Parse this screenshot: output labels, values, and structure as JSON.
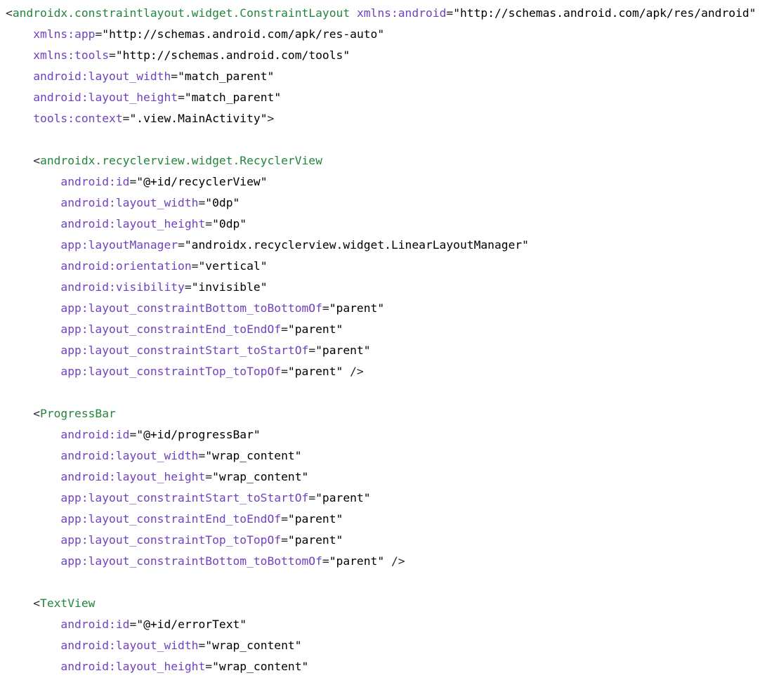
{
  "code": {
    "lines": [
      [
        {
          "t": "<",
          "c": "punct"
        },
        {
          "t": "androidx.constraintlayout.widget.ConstraintLayout",
          "c": "tag"
        },
        {
          "t": " ",
          "c": "punct"
        },
        {
          "t": "xmlns:android",
          "c": "attr"
        },
        {
          "t": "=",
          "c": "punct"
        },
        {
          "t": "\"http://schemas.android.com/apk/res/android\"",
          "c": "str"
        }
      ],
      [
        {
          "t": "    ",
          "c": "punct"
        },
        {
          "t": "xmlns:app",
          "c": "attr"
        },
        {
          "t": "=",
          "c": "punct"
        },
        {
          "t": "\"http://schemas.android.com/apk/res-auto\"",
          "c": "str"
        }
      ],
      [
        {
          "t": "    ",
          "c": "punct"
        },
        {
          "t": "xmlns:tools",
          "c": "attr"
        },
        {
          "t": "=",
          "c": "punct"
        },
        {
          "t": "\"http://schemas.android.com/tools\"",
          "c": "str"
        }
      ],
      [
        {
          "t": "    ",
          "c": "punct"
        },
        {
          "t": "android:layout_width",
          "c": "attr"
        },
        {
          "t": "=",
          "c": "punct"
        },
        {
          "t": "\"match_parent\"",
          "c": "str"
        }
      ],
      [
        {
          "t": "    ",
          "c": "punct"
        },
        {
          "t": "android:layout_height",
          "c": "attr"
        },
        {
          "t": "=",
          "c": "punct"
        },
        {
          "t": "\"match_parent\"",
          "c": "str"
        }
      ],
      [
        {
          "t": "    ",
          "c": "punct"
        },
        {
          "t": "tools:context",
          "c": "attr"
        },
        {
          "t": "=",
          "c": "punct"
        },
        {
          "t": "\".view.MainActivity\"",
          "c": "str"
        },
        {
          "t": ">",
          "c": "punct"
        }
      ],
      [],
      [
        {
          "t": "    <",
          "c": "punct"
        },
        {
          "t": "androidx.recyclerview.widget.RecyclerView",
          "c": "tag"
        }
      ],
      [
        {
          "t": "        ",
          "c": "punct"
        },
        {
          "t": "android:id",
          "c": "attr"
        },
        {
          "t": "=",
          "c": "punct"
        },
        {
          "t": "\"@+id/recyclerView\"",
          "c": "str"
        }
      ],
      [
        {
          "t": "        ",
          "c": "punct"
        },
        {
          "t": "android:layout_width",
          "c": "attr"
        },
        {
          "t": "=",
          "c": "punct"
        },
        {
          "t": "\"0dp\"",
          "c": "str"
        }
      ],
      [
        {
          "t": "        ",
          "c": "punct"
        },
        {
          "t": "android:layout_height",
          "c": "attr"
        },
        {
          "t": "=",
          "c": "punct"
        },
        {
          "t": "\"0dp\"",
          "c": "str"
        }
      ],
      [
        {
          "t": "        ",
          "c": "punct"
        },
        {
          "t": "app:layoutManager",
          "c": "attr"
        },
        {
          "t": "=",
          "c": "punct"
        },
        {
          "t": "\"androidx.recyclerview.widget.LinearLayoutManager\"",
          "c": "str"
        }
      ],
      [
        {
          "t": "        ",
          "c": "punct"
        },
        {
          "t": "android:orientation",
          "c": "attr"
        },
        {
          "t": "=",
          "c": "punct"
        },
        {
          "t": "\"vertical\"",
          "c": "str"
        }
      ],
      [
        {
          "t": "        ",
          "c": "punct"
        },
        {
          "t": "android:visibility",
          "c": "attr"
        },
        {
          "t": "=",
          "c": "punct"
        },
        {
          "t": "\"invisible\"",
          "c": "str"
        }
      ],
      [
        {
          "t": "        ",
          "c": "punct"
        },
        {
          "t": "app:layout_constraintBottom_toBottomOf",
          "c": "attr"
        },
        {
          "t": "=",
          "c": "punct"
        },
        {
          "t": "\"parent\"",
          "c": "str"
        }
      ],
      [
        {
          "t": "        ",
          "c": "punct"
        },
        {
          "t": "app:layout_constraintEnd_toEndOf",
          "c": "attr"
        },
        {
          "t": "=",
          "c": "punct"
        },
        {
          "t": "\"parent\"",
          "c": "str"
        }
      ],
      [
        {
          "t": "        ",
          "c": "punct"
        },
        {
          "t": "app:layout_constraintStart_toStartOf",
          "c": "attr"
        },
        {
          "t": "=",
          "c": "punct"
        },
        {
          "t": "\"parent\"",
          "c": "str"
        }
      ],
      [
        {
          "t": "        ",
          "c": "punct"
        },
        {
          "t": "app:layout_constraintTop_toTopOf",
          "c": "attr"
        },
        {
          "t": "=",
          "c": "punct"
        },
        {
          "t": "\"parent\"",
          "c": "str"
        },
        {
          "t": " />",
          "c": "punct"
        }
      ],
      [],
      [
        {
          "t": "    <",
          "c": "punct"
        },
        {
          "t": "ProgressBar",
          "c": "tag"
        }
      ],
      [
        {
          "t": "        ",
          "c": "punct"
        },
        {
          "t": "android:id",
          "c": "attr"
        },
        {
          "t": "=",
          "c": "punct"
        },
        {
          "t": "\"@+id/progressBar\"",
          "c": "str"
        }
      ],
      [
        {
          "t": "        ",
          "c": "punct"
        },
        {
          "t": "android:layout_width",
          "c": "attr"
        },
        {
          "t": "=",
          "c": "punct"
        },
        {
          "t": "\"wrap_content\"",
          "c": "str"
        }
      ],
      [
        {
          "t": "        ",
          "c": "punct"
        },
        {
          "t": "android:layout_height",
          "c": "attr"
        },
        {
          "t": "=",
          "c": "punct"
        },
        {
          "t": "\"wrap_content\"",
          "c": "str"
        }
      ],
      [
        {
          "t": "        ",
          "c": "punct"
        },
        {
          "t": "app:layout_constraintStart_toStartOf",
          "c": "attr"
        },
        {
          "t": "=",
          "c": "punct"
        },
        {
          "t": "\"parent\"",
          "c": "str"
        }
      ],
      [
        {
          "t": "        ",
          "c": "punct"
        },
        {
          "t": "app:layout_constraintEnd_toEndOf",
          "c": "attr"
        },
        {
          "t": "=",
          "c": "punct"
        },
        {
          "t": "\"parent\"",
          "c": "str"
        }
      ],
      [
        {
          "t": "        ",
          "c": "punct"
        },
        {
          "t": "app:layout_constraintTop_toTopOf",
          "c": "attr"
        },
        {
          "t": "=",
          "c": "punct"
        },
        {
          "t": "\"parent\"",
          "c": "str"
        }
      ],
      [
        {
          "t": "        ",
          "c": "punct"
        },
        {
          "t": "app:layout_constraintBottom_toBottomOf",
          "c": "attr"
        },
        {
          "t": "=",
          "c": "punct"
        },
        {
          "t": "\"parent\"",
          "c": "str"
        },
        {
          "t": " />",
          "c": "punct"
        }
      ],
      [],
      [
        {
          "t": "    <",
          "c": "punct"
        },
        {
          "t": "TextView",
          "c": "tag"
        }
      ],
      [
        {
          "t": "        ",
          "c": "punct"
        },
        {
          "t": "android:id",
          "c": "attr"
        },
        {
          "t": "=",
          "c": "punct"
        },
        {
          "t": "\"@+id/errorText\"",
          "c": "str"
        }
      ],
      [
        {
          "t": "        ",
          "c": "punct"
        },
        {
          "t": "android:layout_width",
          "c": "attr"
        },
        {
          "t": "=",
          "c": "punct"
        },
        {
          "t": "\"wrap_content\"",
          "c": "str"
        }
      ],
      [
        {
          "t": "        ",
          "c": "punct"
        },
        {
          "t": "android:layout_height",
          "c": "attr"
        },
        {
          "t": "=",
          "c": "punct"
        },
        {
          "t": "\"wrap_content\"",
          "c": "str"
        }
      ]
    ],
    "colors": {
      "tag": "#22863a",
      "attr": "#6f42c1",
      "string": "#000000",
      "punct": "#24292e"
    }
  }
}
